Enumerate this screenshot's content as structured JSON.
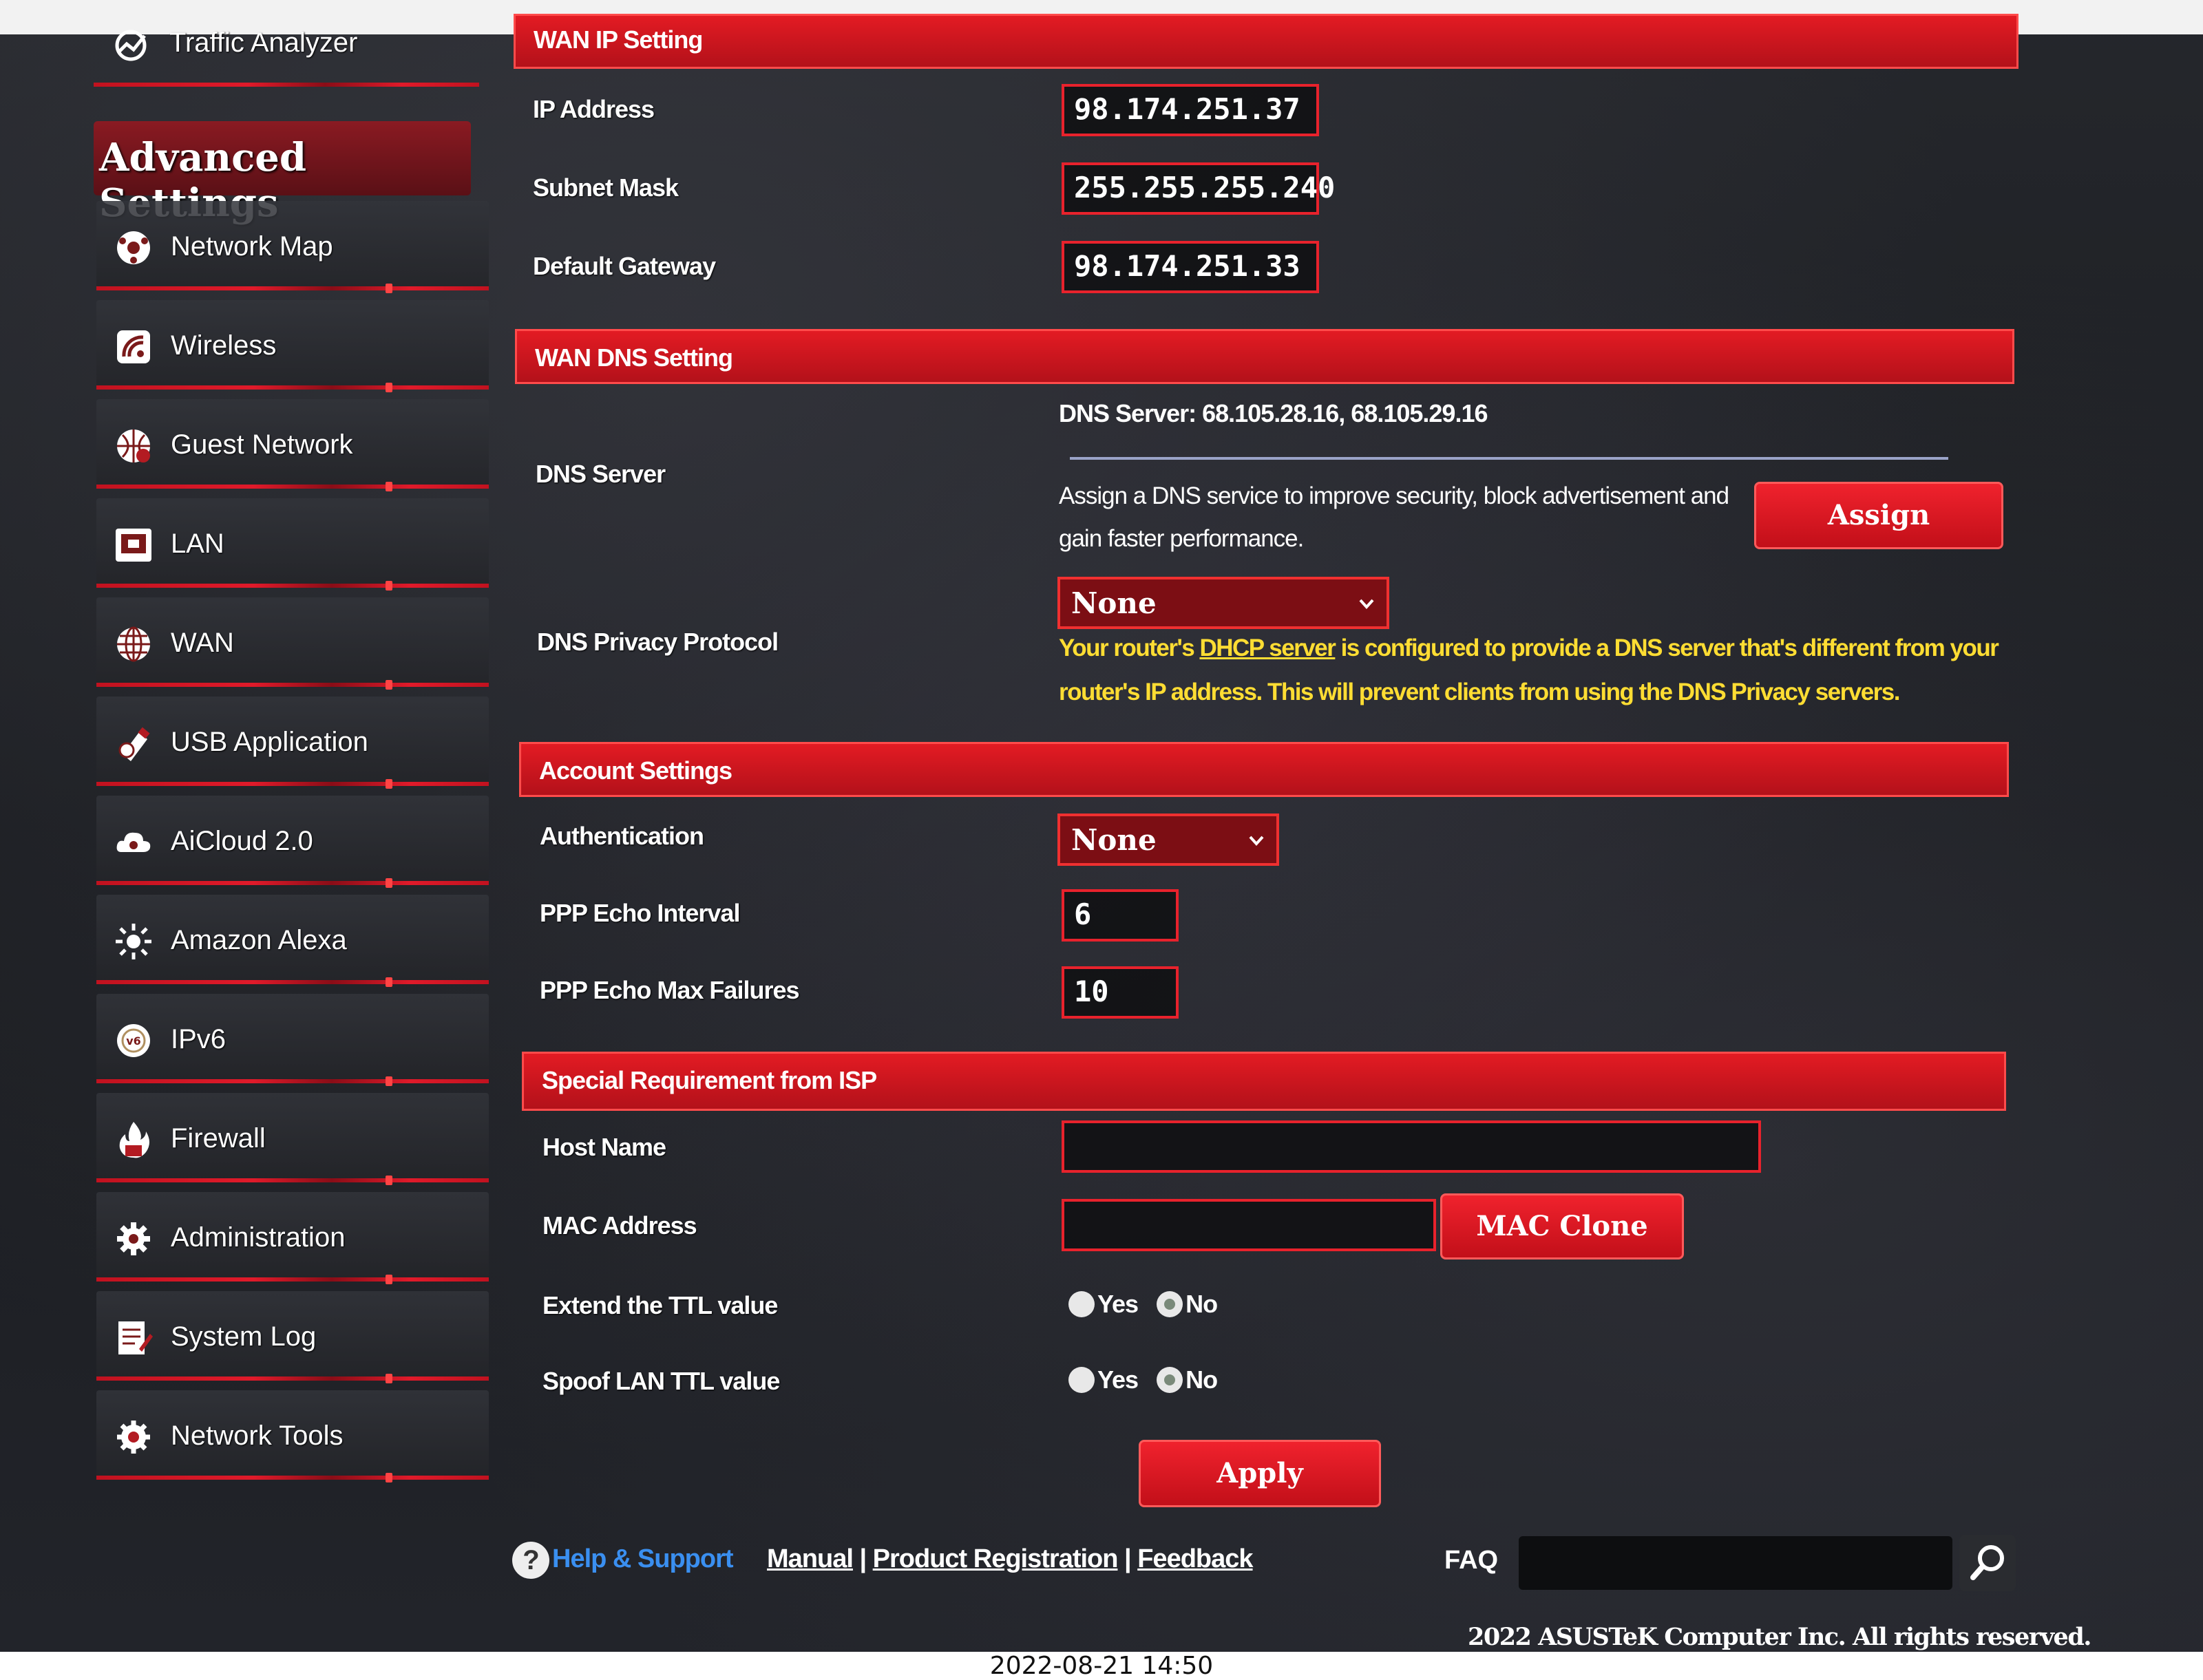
{
  "browser": {
    "url_fragment": "Advanced_WAN_Content.asp"
  },
  "sidebar": {
    "top_item": "Traffic Analyzer",
    "section_title": "Advanced Settings",
    "items": [
      {
        "label": "Network Map",
        "icon": "network-map-icon"
      },
      {
        "label": "Wireless",
        "icon": "wireless-icon"
      },
      {
        "label": "Guest Network",
        "icon": "guest-network-icon"
      },
      {
        "label": "LAN",
        "icon": "lan-icon"
      },
      {
        "label": "WAN",
        "icon": "wan-globe-icon"
      },
      {
        "label": "USB Application",
        "icon": "usb-application-icon"
      },
      {
        "label": "AiCloud 2.0",
        "icon": "aicloud-icon"
      },
      {
        "label": "Amazon Alexa",
        "icon": "alexa-icon"
      },
      {
        "label": "IPv6",
        "icon": "ipv6-icon"
      },
      {
        "label": "Firewall",
        "icon": "firewall-icon"
      },
      {
        "label": "Administration",
        "icon": "administration-gear-icon"
      },
      {
        "label": "System Log",
        "icon": "system-log-icon"
      },
      {
        "label": "Network Tools",
        "icon": "network-tools-icon"
      }
    ]
  },
  "wan_ip": {
    "title": "WAN IP Setting",
    "ip_label": "IP Address",
    "ip_value": "98.174.251.37",
    "mask_label": "Subnet Mask",
    "mask_value": "255.255.255.240",
    "gateway_label": "Default Gateway",
    "gateway_value": "98.174.251.33"
  },
  "wan_dns": {
    "title": "WAN DNS Setting",
    "dns_label": "DNS Server",
    "dns_server_text": "DNS Server: 68.105.28.16, 68.105.29.16",
    "assign_desc": "Assign a DNS service to improve security, block advertisement and gain faster performance.",
    "assign_button": "Assign",
    "privacy_label": "DNS Privacy Protocol",
    "privacy_value": "None",
    "warning_pre": "Your router's ",
    "warning_link": "DHCP server",
    "warning_post": " is configured to provide a DNS server that's different from your router's IP address. This will prevent clients from using the DNS Privacy servers."
  },
  "account": {
    "title": "Account Settings",
    "auth_label": "Authentication",
    "auth_value": "None",
    "echo_interval_label": "PPP Echo Interval",
    "echo_interval_value": "6",
    "echo_fail_label": "PPP Echo Max Failures",
    "echo_fail_value": "10"
  },
  "isp": {
    "title": "Special Requirement from ISP",
    "host_label": "Host Name",
    "host_value": "",
    "mac_label": "MAC Address",
    "mac_value": "",
    "mac_clone_button": "MAC Clone",
    "ttl_label": "Extend the TTL value",
    "spoof_label": "Spoof LAN TTL value",
    "yes": "Yes",
    "no": "No"
  },
  "apply_button": "Apply",
  "footer": {
    "help": "Help & Support",
    "manual": "Manual",
    "sep": " | ",
    "registration": "Product Registration",
    "feedback": "Feedback",
    "faq": "FAQ",
    "copyright": "2022 ASUSTeK Computer Inc. All rights reserved."
  },
  "photo_timestamp": "2022-08-21 14:50",
  "colors": {
    "accent": "#e31b23",
    "warning": "#ffdd33",
    "link": "#3a8ff0"
  }
}
